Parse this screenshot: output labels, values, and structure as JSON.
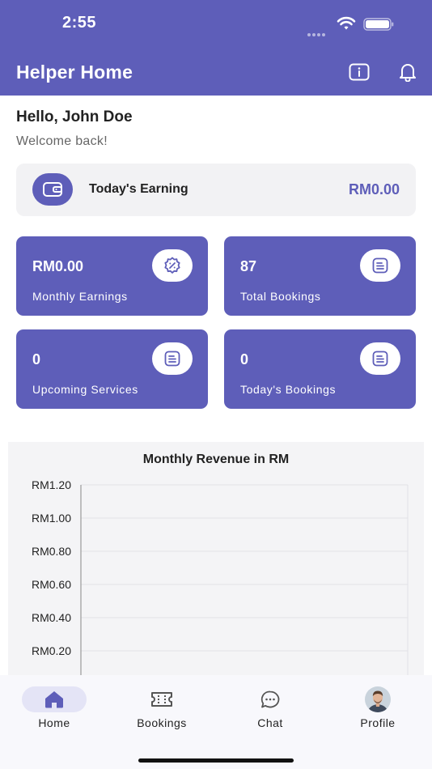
{
  "status_bar": {
    "time": "2:55"
  },
  "header": {
    "title": "Helper Home",
    "info_icon": "info-icon",
    "bell_icon": "bell-icon"
  },
  "greeting": {
    "hello": "Hello, John Doe",
    "welcome": "Welcome back!"
  },
  "today_earning": {
    "label": "Today's Earning",
    "value": "RM0.00",
    "icon": "wallet-icon"
  },
  "stats": [
    {
      "value": "RM0.00",
      "label": "Monthly Earnings",
      "icon": "discount-badge-icon"
    },
    {
      "value": "87",
      "label": "Total Bookings",
      "icon": "document-list-icon"
    },
    {
      "value": "0",
      "label": "Upcoming Services",
      "icon": "document-list-icon"
    },
    {
      "value": "0",
      "label": "Today's Bookings",
      "icon": "document-list-icon"
    }
  ],
  "colors": {
    "primary": "#5e5eb9",
    "card_bg": "#f2f2f4",
    "nav_active_bg": "#e4e4f6"
  },
  "chart_data": {
    "type": "line",
    "title": "Monthly Revenue in RM",
    "xlabel": "",
    "ylabel": "",
    "y_ticks": [
      "RM1.20",
      "RM1.00",
      "RM0.80",
      "RM0.60",
      "RM0.40",
      "RM0.20"
    ],
    "ylim": [
      0,
      1.2
    ],
    "series": [],
    "grid": true
  },
  "nav": [
    {
      "label": "Home",
      "icon": "home-icon",
      "active": true
    },
    {
      "label": "Bookings",
      "icon": "ticket-icon",
      "active": false
    },
    {
      "label": "Chat",
      "icon": "chat-bubble-icon",
      "active": false
    },
    {
      "label": "Profile",
      "icon": "avatar-icon",
      "active": false
    }
  ]
}
